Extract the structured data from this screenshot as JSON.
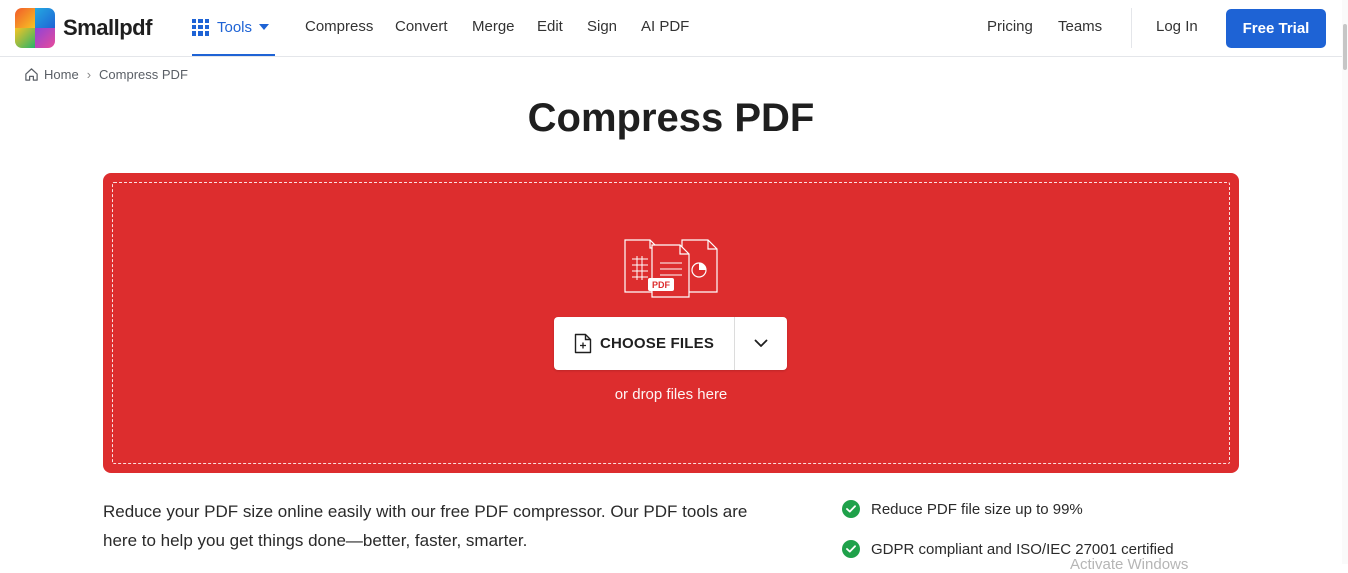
{
  "brand": {
    "name": "Smallpdf",
    "logo_colors": [
      "#f25a2a",
      "#24a9e1",
      "#f7c423",
      "#8e44d8",
      "#e94b9a",
      "#27b36b"
    ]
  },
  "nav": {
    "tools_label": "Tools",
    "items": [
      "Compress",
      "Convert",
      "Merge",
      "Edit",
      "Sign",
      "AI PDF"
    ],
    "right": [
      "Pricing",
      "Teams"
    ],
    "login": "Log In",
    "trial": "Free Trial"
  },
  "breadcrumb": {
    "home": "Home",
    "current": "Compress PDF"
  },
  "page": {
    "title": "Compress PDF"
  },
  "dropzone": {
    "choose_label": "CHOOSE FILES",
    "hint": "or drop files here",
    "file_badge": "PDF",
    "accent": "#dd2d2e"
  },
  "description": "Reduce your PDF size online easily with our free PDF compressor. Our PDF tools are here to help you get things done—better, faster, smarter.",
  "features": [
    "Reduce PDF file size up to 99%",
    "GDPR compliant and ISO/IEC 27001 certified"
  ],
  "watermark": "Activate Windows",
  "colors": {
    "primary": "#1e63d5",
    "success": "#1fa14a"
  }
}
